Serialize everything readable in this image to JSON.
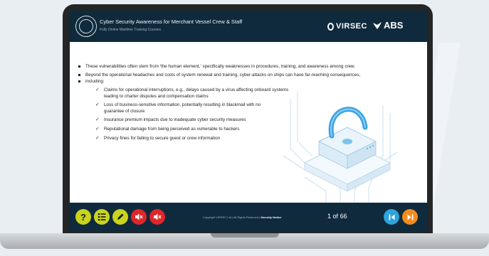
{
  "header": {
    "title": "Cyber Security Awareness for Merchant Vessel Crew & Staff",
    "subtitle": "Fully Online Maritime Training Courses",
    "logo1": "VIRSEC",
    "logo2": "ABS"
  },
  "content": {
    "bullets": [
      "These vulnerabilities often stem from 'the human element,' specifically weaknesses in procedures, training, and awareness among crew.",
      "Beyond the operational headaches and costs of system renewal and training, cyber-attacks on ships can have far-reaching consequences,",
      "including:"
    ],
    "checks": [
      "Claims for operational interruptions, e.g., delays caused by a virus affecting onboard systems",
      "leading to charter disputes and compensation claims",
      "Loss of business-sensitive information, potentially resulting in blackmail with no",
      "guarantee of closure",
      "Insurance premium impacts due to inadequate cyber security measures",
      "Reputational damage from being perceived as vulnerable to hackers",
      "Privacy fines for failing to secure guest or crew information"
    ]
  },
  "footer": {
    "copyright_prefix": "Copyright VIRSEC Ltd | All Rights Reserved |",
    "security_notice": "Security Notice",
    "page_current": "1",
    "page_of": "of",
    "page_total": "66",
    "help_label": "?",
    "colors": {
      "help": "#c8d41e",
      "menu": "#c8d41e",
      "notes": "#c8d41e",
      "audio": "#e0262b",
      "first": "#2ea3dd",
      "last": "#f28c1e"
    }
  },
  "icons": [
    "help-icon",
    "menu-list-icon",
    "pencil-icon",
    "speaker-mute-icon",
    "speaker-mute-icon",
    "first-page-icon",
    "last-page-icon"
  ]
}
